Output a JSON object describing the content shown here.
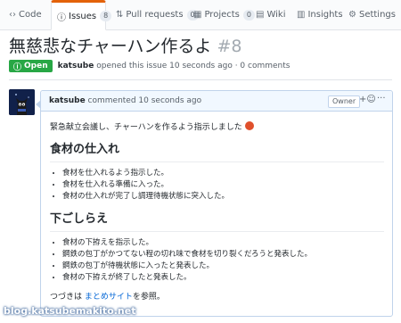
{
  "tabs": [
    {
      "label": "Code",
      "icon": "code-icon",
      "glyph": "‹›",
      "count": null,
      "selected": false
    },
    {
      "label": "Issues",
      "icon": "issue-opened-icon",
      "glyph": "ⓘ",
      "count": "8",
      "selected": true
    },
    {
      "label": "Pull requests",
      "icon": "git-pull-request-icon",
      "glyph": "⇅",
      "count": "0",
      "selected": false
    },
    {
      "label": "Projects",
      "icon": "project-icon",
      "glyph": "▦",
      "count": "0",
      "selected": false
    },
    {
      "label": "Wiki",
      "icon": "book-icon",
      "glyph": "▤",
      "count": null,
      "selected": false
    },
    {
      "label": "Insights",
      "icon": "graph-icon",
      "glyph": "▥",
      "count": null,
      "selected": false
    },
    {
      "label": "Settings",
      "icon": "gear-icon",
      "glyph": "⚙",
      "count": null,
      "selected": false
    }
  ],
  "issue": {
    "title": "無慈悲なチャーハン作るよ",
    "number": "#8",
    "state": "Open",
    "state_icon": "issue-opened-icon",
    "author": "katsube",
    "opened_text": "opened this issue 10 seconds ago · 0 comments"
  },
  "comment": {
    "author": "katsube",
    "time_text": "commented 10 seconds ago",
    "role_badge": "Owner",
    "reaction_icon": "add-reaction-icon",
    "more_icon": "kebab-horizontal-icon",
    "intro": "緊急献立会議し、チャーハンを作るよう指示しました",
    "intro_emoji": "angry-face-emoji",
    "sections": [
      {
        "heading": "食材の仕入れ",
        "items": [
          "食材を仕入れるよう指示した。",
          "食材を仕入れる準備に入った。",
          "食材の仕入れが完了し調理待機状態に突入した。"
        ]
      },
      {
        "heading": "下ごしらえ",
        "items": [
          "食材の下拵えを指示した。",
          "鋼鉄の包丁がかつてない程の切れ味で食材を切り裂くだろうと発表した。",
          "鋼鉄の包丁が待機状態に入ったと発表した。",
          "食材の下拵えが終了したと発表した。"
        ]
      }
    ],
    "footer_prefix": "つづきは",
    "footer_link": "まとめサイト",
    "footer_suffix": "を参照。"
  },
  "watermark": "blog.katsubemakito.net",
  "colors": {
    "open_green": "#28a745",
    "tab_accent": "#e36209",
    "link_blue": "#0366d6",
    "comment_header_bg": "#f1f8ff"
  }
}
